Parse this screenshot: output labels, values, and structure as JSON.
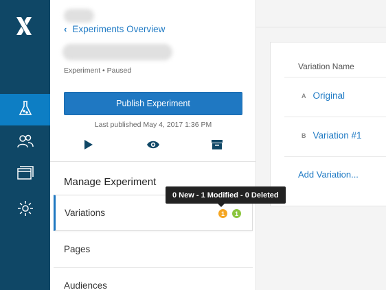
{
  "nav": {
    "logo_icon": "optimizely-x-logo",
    "items": [
      {
        "icon": "flask-icon",
        "active": true
      },
      {
        "icon": "audiences-icon",
        "active": false
      },
      {
        "icon": "windows-icon",
        "active": false
      },
      {
        "icon": "gear-icon",
        "active": false
      }
    ]
  },
  "panel": {
    "back_label": "Experiments Overview",
    "meta": "Experiment • Paused",
    "publish_label": "Publish Experiment",
    "last_published": "Last published May 4, 2017 1:36 PM",
    "section_title": "Manage Experiment",
    "menu": [
      {
        "label": "Variations",
        "active": true
      },
      {
        "label": "Pages",
        "active": false
      },
      {
        "label": "Audiences",
        "active": false
      }
    ],
    "badges": [
      {
        "value": "1",
        "color": "#f5a623"
      },
      {
        "value": "1",
        "color": "#8cc63f"
      }
    ]
  },
  "tooltip": "0 New - 1 Modified - 0 Deleted",
  "variations": {
    "header": "Variation Name",
    "rows": [
      {
        "letter": "A",
        "name": "Original"
      },
      {
        "letter": "B",
        "name": "Variation #1"
      }
    ],
    "add_label": "Add Variation..."
  },
  "colors": {
    "nav_bg": "#0f4766",
    "nav_active": "#0d7ec4",
    "accent": "#1f78c2"
  }
}
